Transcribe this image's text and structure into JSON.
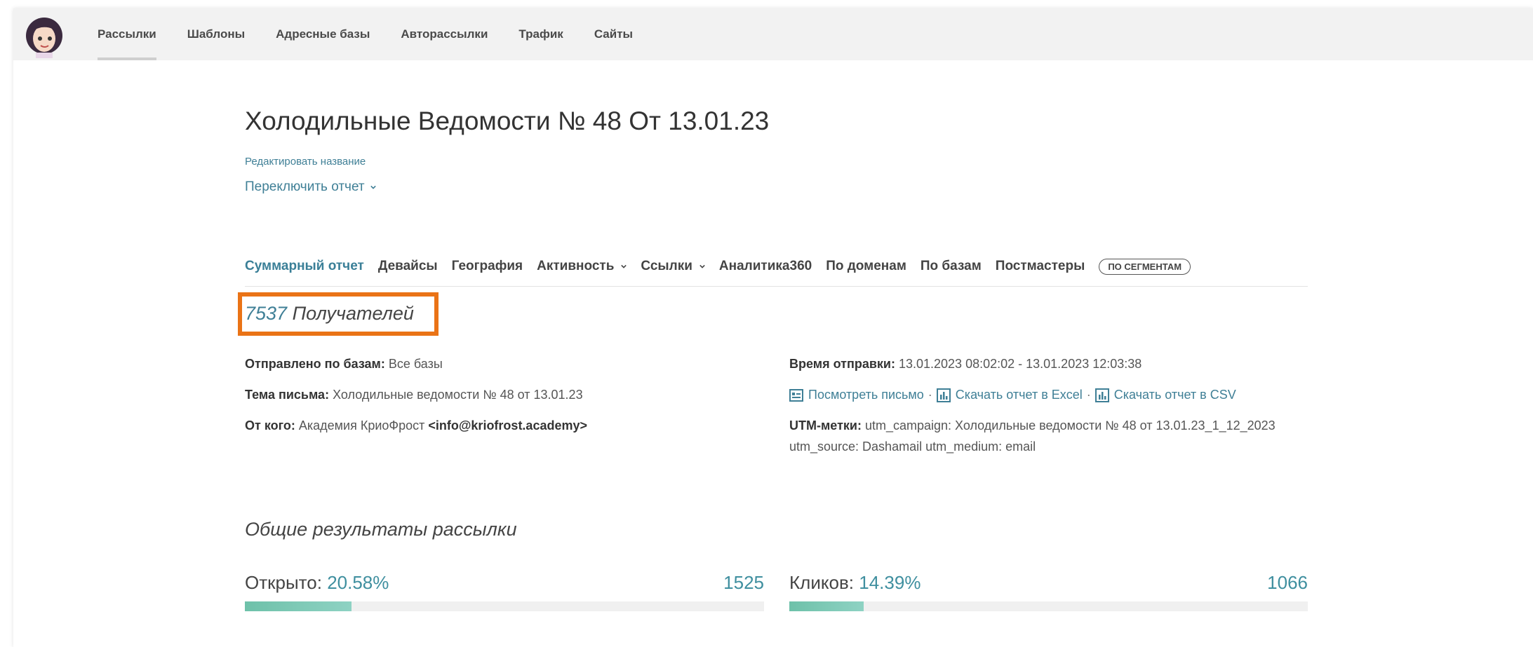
{
  "nav": {
    "items": [
      {
        "label": "Рассылки",
        "active": true
      },
      {
        "label": "Шаблоны"
      },
      {
        "label": "Адресные базы"
      },
      {
        "label": "Авторассылки"
      },
      {
        "label": "Трафик"
      },
      {
        "label": "Сайты"
      }
    ]
  },
  "header": {
    "title": "Холодильные Ведомости № 48 От 13.01.23",
    "edit_link": "Редактировать название",
    "switch_report": "Переключить отчет"
  },
  "tabs": {
    "summary": "Суммарный отчет",
    "devices": "Девайсы",
    "geo": "География",
    "activity": "Активность",
    "links": "Ссылки",
    "analytics": "Аналитика360",
    "domains": "По доменам",
    "bases": "По базам",
    "postmasters": "Постмастеры",
    "segments": "ПО СЕГМЕНТАМ"
  },
  "recipients": {
    "count": "7537",
    "label": "Получателей"
  },
  "info": {
    "sent_label": "Отправлено по базам:",
    "sent_value": "Все базы",
    "subject_label": "Тема письма:",
    "subject_value": "Холодильные ведомости № 48 от 13.01.23",
    "from_label": "От кого:",
    "from_name": "Академия КриоФрост",
    "from_email": "<info@kriofrost.academy>",
    "time_label": "Время отправки:",
    "time_value": "13.01.2023 08:02:02 - 13.01.2023 12:03:38",
    "view_letter": "Посмотреть письмо",
    "excel": "Скачать отчет в Excel",
    "csv": "Скачать отчет в CSV",
    "utm_label": "UTM-метки:",
    "utm_line1": "utm_campaign: Холодильные ведомости № 48 от 13.01.23_1_12_2023",
    "utm_line2": "utm_source: Dashamail utm_medium: email",
    "separator": "·"
  },
  "results": {
    "title": "Общие результаты рассылки",
    "opened_label": "Открыто:",
    "opened_pct": "20.58%",
    "opened_count": "1525",
    "opened_fraction": 0.2058,
    "clicks_label": "Кликов:",
    "clicks_pct": "14.39%",
    "clicks_count": "1066",
    "clicks_fraction": 0.1439
  },
  "colors": {
    "accent": "#3f7f96",
    "highlight": "#ea7316",
    "bar": "#7cc9b5"
  }
}
